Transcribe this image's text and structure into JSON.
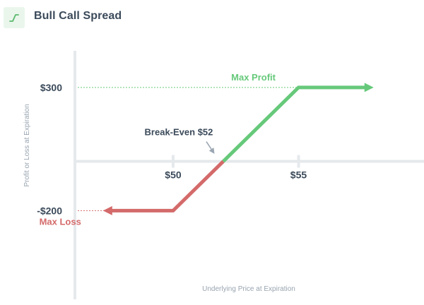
{
  "header": {
    "title": "Bull Call Spread",
    "icon": "payoff-line-icon"
  },
  "colors": {
    "profit": "#66c97a",
    "loss": "#d46a6a",
    "axis": "#e6e9ec",
    "text": "#3b4a5a",
    "muted": "#98a4b0",
    "arrow": "#9aa6b2"
  },
  "chart_data": {
    "type": "line",
    "title": "",
    "xlabel": "Underlying Price at Expiration",
    "ylabel": "Profit or Loss at Expiration",
    "x_ticks": [
      {
        "value": 50,
        "label": "$50"
      },
      {
        "value": 55,
        "label": "$55"
      }
    ],
    "y_ticks": [
      {
        "value": 300,
        "label": "$300"
      },
      {
        "value": -200,
        "label": "-$200"
      }
    ],
    "xlim": [
      43.1,
      60
    ],
    "ylim": [
      -560,
      460
    ],
    "series": [
      {
        "segment": "loss",
        "x": [
          47.5,
          50,
          52
        ],
        "y": [
          -200,
          -200,
          0
        ],
        "arrow": "start"
      },
      {
        "segment": "profit",
        "x": [
          52,
          55,
          57.7
        ],
        "y": [
          0,
          300,
          300
        ],
        "arrow": "end"
      }
    ],
    "annotations": [
      {
        "id": "max-profit",
        "text": "Max Profit",
        "x": 53.2,
        "y": 300
      },
      {
        "id": "max-loss",
        "text": "Max Loss",
        "x": 45.5,
        "y": -200
      },
      {
        "id": "break-even",
        "text": "Break-Even $52",
        "x": 52,
        "y": 0
      }
    ]
  }
}
